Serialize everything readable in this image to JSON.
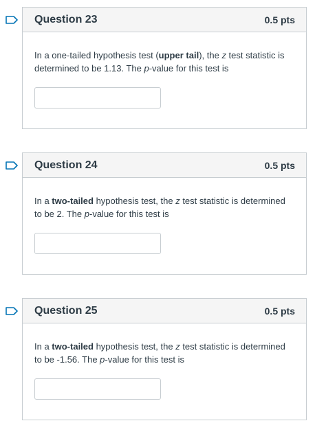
{
  "icons": {
    "flag": "flag-bookmark-icon"
  },
  "colors": {
    "flag_stroke": "#0374b5",
    "header_bg": "#f5f5f5",
    "border": "#c7cdd1",
    "text": "#2d3b45"
  },
  "questions": [
    {
      "title": "Question 23",
      "points": "0.5 pts",
      "text_parts": [
        "In a one-tailed hypothesis test (",
        "upper tail",
        "), the ",
        "z",
        " test statistic is determined to be 1.13. The ",
        "p",
        "-value for this test is"
      ],
      "answer_value": ""
    },
    {
      "title": "Question 24",
      "points": "0.5 pts",
      "text_parts": [
        "In a ",
        "two-tailed",
        " hypothesis test, the ",
        "z",
        " test statistic is determined to be 2. The ",
        "p",
        "-value for this test is"
      ],
      "answer_value": ""
    },
    {
      "title": "Question 25",
      "points": "0.5 pts",
      "text_parts": [
        "In a ",
        "two-tailed",
        " hypothesis test, the ",
        "z",
        " test statistic is determined to be -1.56. The ",
        "p",
        "-value for this test is"
      ],
      "answer_value": ""
    }
  ]
}
